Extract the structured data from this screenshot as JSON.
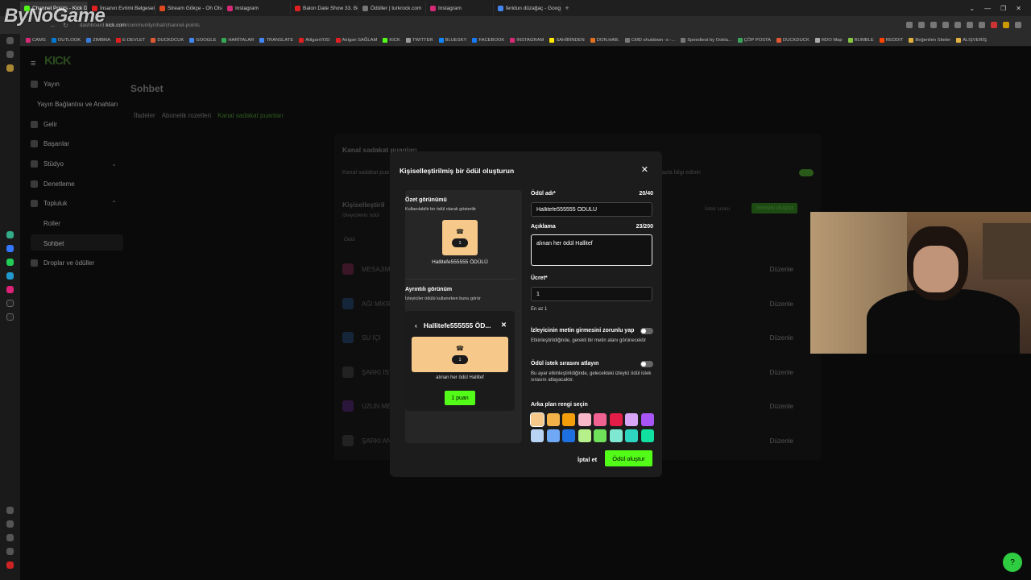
{
  "browser": {
    "tabs": [
      {
        "label": "Channel Points - Kick Da",
        "color": "#53fc18",
        "active": true
      },
      {
        "label": "İnsanın Evrimi Belgeseli -",
        "color": "#e02020"
      },
      {
        "label": "Stream Gökçe - Oh Olsun",
        "color": "#e04a20"
      },
      {
        "label": "Instagram",
        "color": "#d62976"
      },
      {
        "label": "Balon Date Show 33. Bölü",
        "color": "#e02020"
      },
      {
        "label": "Ödüller | turkrock.com",
        "color": "#777777"
      },
      {
        "label": "Instagram",
        "color": "#d62976"
      },
      {
        "label": "feridun düzağaç - Google",
        "color": "#4285f4"
      }
    ],
    "new_tab": "+",
    "window_controls": [
      "⌄",
      "—",
      "❐",
      "✕"
    ],
    "url_prefix": "dashboard.",
    "url_host": "kick.com",
    "url_path": "/community/chat/channel-points",
    "bookmarks": [
      {
        "label": "CAMS",
        "color": "#d62976"
      },
      {
        "label": "OUTLOOK",
        "color": "#0078d4"
      },
      {
        "label": "ZIMBRA",
        "color": "#3a7bd5"
      },
      {
        "label": "E-DEVLET",
        "color": "#e02020"
      },
      {
        "label": "DUCKDCUK",
        "color": "#de5833"
      },
      {
        "label": "GOOGLE",
        "color": "#4285f4"
      },
      {
        "label": "HARİTALAR",
        "color": "#34a853"
      },
      {
        "label": "TRANSLATE",
        "color": "#4285f4"
      },
      {
        "label": "AtilganVOD",
        "color": "#e02020"
      },
      {
        "label": "Atılgan SAĞLAM",
        "color": "#e02020"
      },
      {
        "label": "KICK",
        "color": "#53fc18"
      },
      {
        "label": "TWITTER",
        "color": "#999999"
      },
      {
        "label": "BLUESKY",
        "color": "#1185fe"
      },
      {
        "label": "FACEBOOK",
        "color": "#1877f2"
      },
      {
        "label": "INSTAGRAM",
        "color": "#d62976"
      },
      {
        "label": "SAHİBİNDEN",
        "color": "#ffe800"
      },
      {
        "label": "DON.HAB.",
        "color": "#e07020"
      },
      {
        "label": "CMD shutdown -s -...",
        "color": "#777777"
      },
      {
        "label": "Speedtest by Ookla...",
        "color": "#777777"
      },
      {
        "label": "ÇÖP POSTA",
        "color": "#3aa35a"
      },
      {
        "label": "DUCKDUCK",
        "color": "#de5833"
      },
      {
        "label": "RDO Map",
        "color": "#aaaaaa"
      },
      {
        "label": "RUMBLE",
        "color": "#85c742"
      },
      {
        "label": "REDDIT",
        "color": "#ff4500"
      },
      {
        "label": "Beğenilen Siteler",
        "color": "#e0b040"
      },
      {
        "label": "ALIŞVERİŞ",
        "color": "#e0b040"
      }
    ]
  },
  "overlay_logo": "ByNoGame",
  "sidebar": {
    "items": [
      {
        "label": "Yayın"
      },
      {
        "label": "Yayın Bağlantısı ve Anahtarı",
        "sub": true
      },
      {
        "label": "Gelir"
      },
      {
        "label": "Başarılar"
      },
      {
        "label": "Stüdyo",
        "chevron": "⌄"
      },
      {
        "label": "Denetleme"
      },
      {
        "label": "Topluluk",
        "chevron": "⌃"
      },
      {
        "label": "Roller",
        "sub": true
      },
      {
        "label": "Sohbet",
        "sub": true
      },
      {
        "label": "Droplar ve ödüller"
      }
    ]
  },
  "main": {
    "title": "Sohbet",
    "tabs": [
      "İfadeler",
      "Abonelik rozetleri",
      "Kanal sadakat puanları"
    ],
    "bg_card_title": "Kanal sadakat puanları",
    "bg_card_row": "Kanal sadakat pua",
    "bg_card_more": "fazla bilgi edinin",
    "bg_custom_title": "Kişiselleştiril",
    "bg_custom_sub": "İzleyicilerin ödül",
    "bg_request_queue": "İstek sırası",
    "bg_create_new": "Yenisini oluştur",
    "bg_col_header": "Ödül",
    "bg_rows": [
      {
        "label": "MESAJIMI",
        "color": "#3a1626"
      },
      {
        "label": "AĞI MİKRO",
        "color": "#16263a"
      },
      {
        "label": "SU İÇİ",
        "color": "#16263a"
      },
      {
        "label": "ŞARKI İST",
        "color": "#222222"
      },
      {
        "label": "UZUN MES",
        "color": "#2a163a"
      },
      {
        "label": "ŞARKI ANA",
        "color": "#222222"
      }
    ],
    "bg_edit_label": "Düzenle"
  },
  "modal": {
    "title": "Kişiselleştirilmiş bir ödül oluşturun",
    "close": "✕",
    "preview": {
      "summary_title": "Özet görünümü",
      "summary_sub": "Kullanılabilir bir ödül olarak gösterilir",
      "tile_cost": "1",
      "tile_name": "Hallitefe555555 ÖDÜLÜ",
      "detail_title": "Ayrıntılı görünüm",
      "detail_sub": "İzleyiciler ödülü kullanırken bunu görür",
      "detail_reward_name": "Hallitefe555555 ÖD...",
      "detail_back": "‹",
      "detail_close": "✕",
      "detail_cost": "1",
      "detail_desc": "alınan her ödül Hallitef",
      "detail_button": "1 puan"
    },
    "form": {
      "name_label": "Ödül adı*",
      "name_count": "20/40",
      "name_value": "Hallitefe555555 ÖDÜLÜ",
      "desc_label": "Açıklama",
      "desc_count": "23/200",
      "desc_value": "alınan her ödül Hallitef",
      "cost_label": "Ücret*",
      "cost_value": "1",
      "cost_help": "En az 1",
      "force_text_label": "İzleyicinin metin girmesini zorunlu yap",
      "force_text_help": "Etkinleştirildiğinde, gerekli bir metin alanı görünecektir",
      "force_text_on": false,
      "skip_queue_label": "Ödül istek sırasını atlayın",
      "skip_queue_help": "Bu ayar etkinleştirildiğinde, gelecekteki izleyici ödül istek sırasını atlayacaktır.",
      "skip_queue_on": false,
      "bg_label": "Arka plan rengi seçin",
      "swatches": [
        "#f6c98a",
        "#f3b14a",
        "#f59e0b",
        "#f9b8c9",
        "#f06292",
        "#e11d48",
        "#d8a4f5",
        "#a855f7",
        "#b9d3f5",
        "#6fa8f5",
        "#1e6fe0",
        "#b5f08a",
        "#6ee05a",
        "#7ee8d2",
        "#2dd4bf",
        "#10e0a0"
      ],
      "selected_swatch": 0
    },
    "cancel": "İptal et",
    "create": "Ödül oluştur"
  },
  "help_icon": "help-icon"
}
